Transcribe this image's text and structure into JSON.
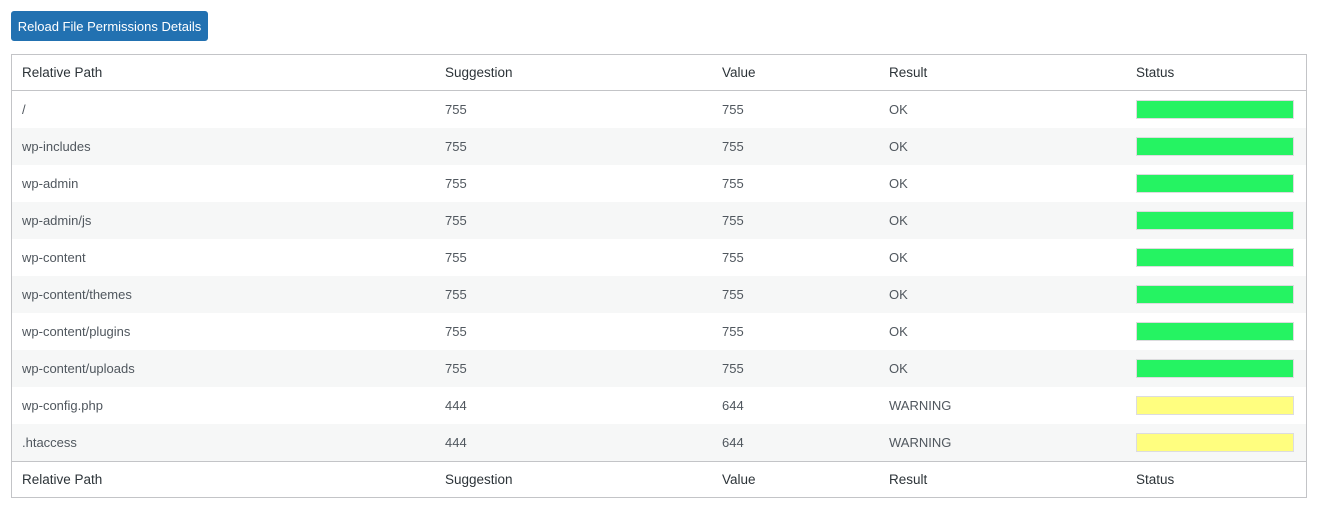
{
  "toolbar": {
    "reload_label": "Reload File Permissions Details"
  },
  "table": {
    "headers": [
      "Relative Path",
      "Suggestion",
      "Value",
      "Result",
      "Status"
    ],
    "footers": [
      "Relative Path",
      "Suggestion",
      "Value",
      "Result",
      "Status"
    ],
    "status_colors": {
      "ok": "#25f362",
      "warning": "#fffe7f"
    },
    "rows": [
      {
        "path": "/",
        "suggestion": "755",
        "value": "755",
        "result": "OK",
        "status": "ok"
      },
      {
        "path": "wp-includes",
        "suggestion": "755",
        "value": "755",
        "result": "OK",
        "status": "ok"
      },
      {
        "path": "wp-admin",
        "suggestion": "755",
        "value": "755",
        "result": "OK",
        "status": "ok"
      },
      {
        "path": "wp-admin/js",
        "suggestion": "755",
        "value": "755",
        "result": "OK",
        "status": "ok"
      },
      {
        "path": "wp-content",
        "suggestion": "755",
        "value": "755",
        "result": "OK",
        "status": "ok"
      },
      {
        "path": "wp-content/themes",
        "suggestion": "755",
        "value": "755",
        "result": "OK",
        "status": "ok"
      },
      {
        "path": "wp-content/plugins",
        "suggestion": "755",
        "value": "755",
        "result": "OK",
        "status": "ok"
      },
      {
        "path": "wp-content/uploads",
        "suggestion": "755",
        "value": "755",
        "result": "OK",
        "status": "ok"
      },
      {
        "path": "wp-config.php",
        "suggestion": "444",
        "value": "644",
        "result": "WARNING",
        "status": "warning"
      },
      {
        "path": ".htaccess",
        "suggestion": "444",
        "value": "644",
        "result": "WARNING",
        "status": "warning"
      }
    ]
  }
}
